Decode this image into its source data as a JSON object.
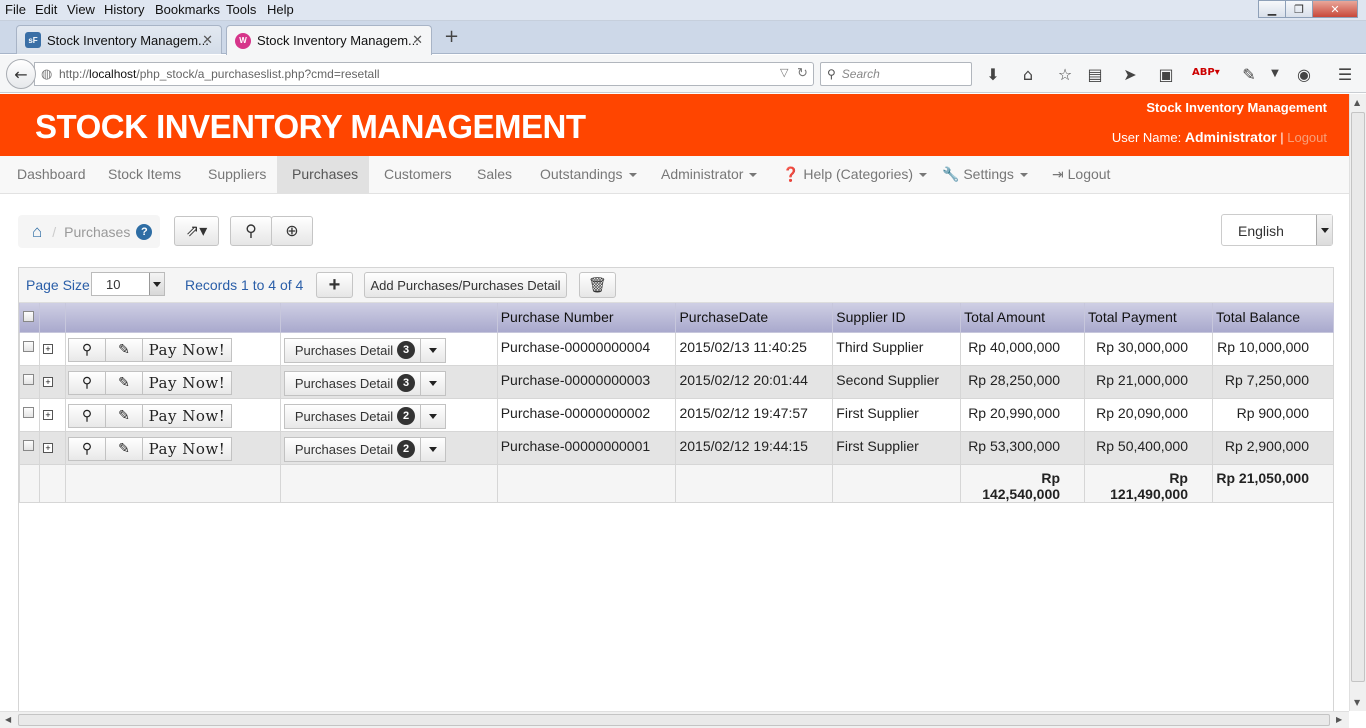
{
  "browser": {
    "menu": [
      "File",
      "Edit",
      "View",
      "History",
      "Bookmarks",
      "Tools",
      "Help"
    ],
    "tabs": [
      {
        "title": "Stock Inventory Managem...",
        "favicon": "sf-favicon",
        "favicon_color": "#3a6fa6"
      },
      {
        "title": "Stock Inventory Managem...",
        "favicon": "w-favicon",
        "favicon_color": "#d6358a"
      }
    ],
    "url_prefix": "http://",
    "url_host": "localhost",
    "url_path": "/php_stock/a_purchaseslist.php?cmd=resetall",
    "search_placeholder": "Search"
  },
  "app": {
    "title": "STOCK INVENTORY MANAGEMENT",
    "subtitle": "Stock Inventory Management",
    "user_label": "User Name: ",
    "user_name": "Administrator",
    "separator": " | ",
    "logout_link": "Logout",
    "brand_color": "#ff4500"
  },
  "nav": {
    "items": [
      {
        "label": "Dashboard"
      },
      {
        "label": "Stock Items"
      },
      {
        "label": "Suppliers"
      },
      {
        "label": "Purchases"
      },
      {
        "label": "Customers"
      },
      {
        "label": "Sales"
      },
      {
        "label": "Outstandings"
      },
      {
        "label": "Administrator"
      },
      {
        "label": "Help (Categories)"
      },
      {
        "label": "Settings"
      },
      {
        "label": "Logout"
      }
    ]
  },
  "breadcrumb": {
    "current": "Purchases"
  },
  "language": {
    "selected": "English"
  },
  "toolbar": {
    "page_size_label": "Page Size",
    "page_size_value": "10",
    "records_text": "Records 1 to 4 of 4",
    "add_button": "Add Purchases/Purchases Detail"
  },
  "table": {
    "headers": [
      "Purchase Number",
      "PurchaseDate",
      "Supplier ID",
      "Total Amount",
      "Total Payment",
      "Total Balance"
    ],
    "pay_label": "Pay Now!",
    "detail_label": "Purchases Detail",
    "rows": [
      {
        "number": "Purchase-00000000004",
        "date": "2015/02/13 11:40:25",
        "supplier": "Third Supplier",
        "amount": "Rp 40,000,000",
        "payment": "Rp 30,000,000",
        "balance": "Rp 10,000,000",
        "details": "3"
      },
      {
        "number": "Purchase-00000000003",
        "date": "2015/02/12 20:01:44",
        "supplier": "Second Supplier",
        "amount": "Rp 28,250,000",
        "payment": "Rp 21,000,000",
        "balance": "Rp 7,250,000",
        "details": "3"
      },
      {
        "number": "Purchase-00000000002",
        "date": "2015/02/12 19:47:57",
        "supplier": "First Supplier",
        "amount": "Rp 20,990,000",
        "payment": "Rp 20,090,000",
        "balance": "Rp 900,000",
        "details": "2"
      },
      {
        "number": "Purchase-00000000001",
        "date": "2015/02/12 19:44:15",
        "supplier": "First Supplier",
        "amount": "Rp 53,300,000",
        "payment": "Rp 50,400,000",
        "balance": "Rp 2,900,000",
        "details": "2"
      }
    ],
    "totals": {
      "amount": "Rp 142,540,000",
      "payment": "Rp 121,490,000",
      "balance": "Rp 21,050,000"
    }
  }
}
